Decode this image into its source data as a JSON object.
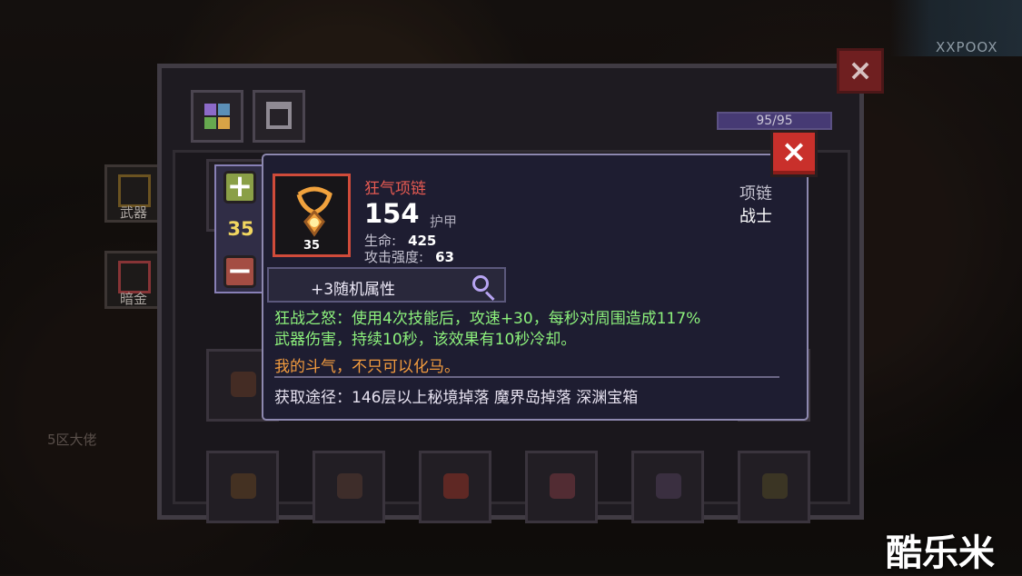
{
  "background": {
    "left_slots": [
      {
        "label": "武器"
      },
      {
        "label": "暗金"
      }
    ],
    "player_name": "5区大佬",
    "watermark_top": "XXPOOX",
    "watermark_bottom": "酷乐米"
  },
  "inventory": {
    "capacity": "95/95",
    "tabs": [
      "inventory",
      "equipment"
    ],
    "close_icon": "close-icon"
  },
  "level_control": {
    "level": "35",
    "plus": "+",
    "minus": "−"
  },
  "tooltip": {
    "name": "狂气项链",
    "armor_value": "154",
    "armor_label": "护甲",
    "stats": [
      {
        "label": "生命:",
        "value": "425"
      },
      {
        "label": "攻击强度:",
        "value": "63"
      }
    ],
    "item_level": "35",
    "category": "项链",
    "class": "战士",
    "random_attributes": "+3随机属性",
    "effect_line_1": "狂战之怒：使用4次技能后，攻速+30，每秒对周围造成117%",
    "effect_line_2": "武器伤害，持续10秒，该效果有10秒冷却。",
    "quote": "我的斗气，不只可以化马。",
    "source": "获取途径：146层以上秘境掉落 魔界岛掉落 深渊宝箱"
  },
  "colors": {
    "item_name": "#e65a52",
    "effect_text": "#8df27c",
    "quote_text": "#f29b3e",
    "level_text": "#f1d660",
    "close_button": "#c9302b"
  }
}
